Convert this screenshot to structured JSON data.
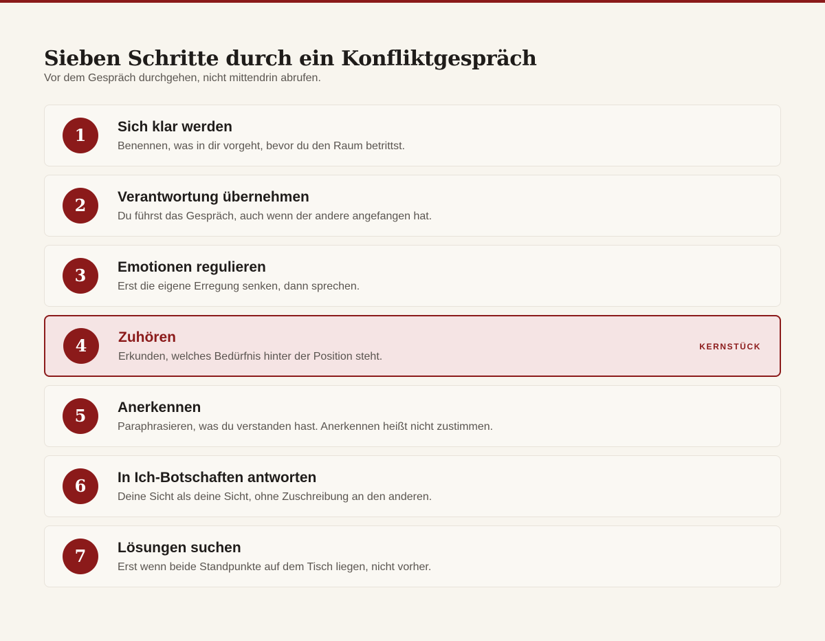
{
  "title": "Sieben Schritte durch ein Konfliktgespräch",
  "subtitle": "Vor dem Gespräch durchgehen, nicht mittendrin abrufen.",
  "colors": {
    "accent": "#8b1a1a",
    "background": "#f8f5ee",
    "highlight_background": "#f5e4e4"
  },
  "steps": [
    {
      "number": "1",
      "title": "Sich klar werden",
      "description": "Benennen, was in dir vorgeht, bevor du den Raum betrittst."
    },
    {
      "number": "2",
      "title": "Verantwortung übernehmen",
      "description": "Du führst das Gespräch, auch wenn der andere angefangen hat."
    },
    {
      "number": "3",
      "title": "Emotionen regulieren",
      "description": "Erst die eigene Erregung senken, dann sprechen."
    },
    {
      "number": "4",
      "title": "Zuhören",
      "description": "Erkunden, welches Bedürfnis hinter der Position steht.",
      "tag": "KERNSTÜCK",
      "highlighted": true
    },
    {
      "number": "5",
      "title": "Anerkennen",
      "description": "Paraphrasieren, was du verstanden hast. Anerkennen heißt nicht zustimmen."
    },
    {
      "number": "6",
      "title": "In Ich-Botschaften antworten",
      "description": "Deine Sicht als deine Sicht, ohne Zuschreibung an den anderen."
    },
    {
      "number": "7",
      "title": "Lösungen suchen",
      "description": "Erst wenn beide Standpunkte auf dem Tisch liegen, nicht vorher."
    }
  ]
}
